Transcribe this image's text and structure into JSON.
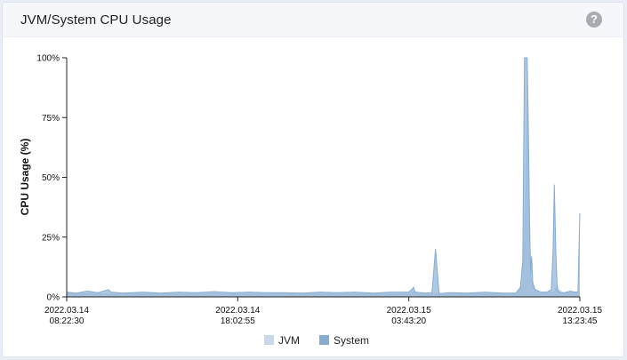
{
  "panel": {
    "title": "JVM/System CPU Usage",
    "help_icon": "question-circle-icon",
    "help_glyph": "?"
  },
  "chart_data": {
    "type": "area",
    "ylabel": "CPU Usage (%)",
    "ylim": [
      0,
      100
    ],
    "yticks": [
      {
        "value": 0,
        "label": "0%"
      },
      {
        "value": 25,
        "label": "25%"
      },
      {
        "value": 50,
        "label": "50%"
      },
      {
        "value": 75,
        "label": "75%"
      },
      {
        "value": 100,
        "label": "100%"
      }
    ],
    "xlim": [
      "2022-03-14T08:22:30",
      "2022-03-15T13:23:45"
    ],
    "xticks": [
      {
        "value": "2022-03-14T08:22:30",
        "date": "2022.03.14",
        "time": "08:22:30"
      },
      {
        "value": "2022-03-14T18:02:55",
        "date": "2022.03.14",
        "time": "18:02:55"
      },
      {
        "value": "2022-03-15T03:43:20",
        "date": "2022.03.15",
        "time": "03:43:20"
      },
      {
        "value": "2022-03-15T13:23:45",
        "date": "2022.03.15",
        "time": "13:23:45"
      }
    ],
    "legend_position": "bottom-center",
    "grid": false,
    "series": [
      {
        "name": "JVM",
        "color": "#c9d9ec",
        "points": [
          [
            "2022-03-14T08:22:30",
            1.5
          ],
          [
            "2022-03-14T09:32:00",
            1.4
          ],
          [
            "2022-03-14T10:44:00",
            1.2
          ],
          [
            "2022-03-14T11:42:00",
            1.3
          ],
          [
            "2022-03-14T13:42:00",
            1.3
          ],
          [
            "2022-03-14T15:42:00",
            1.2
          ],
          [
            "2022-03-14T17:42:00",
            1.3
          ],
          [
            "2022-03-14T19:42:00",
            1.2
          ],
          [
            "2022-03-14T21:42:00",
            1.3
          ],
          [
            "2022-03-14T23:42:00",
            1.2
          ],
          [
            "2022-03-15T01:42:00",
            1.3
          ],
          [
            "2022-03-15T02:42:00",
            1.2
          ],
          [
            "2022-03-15T03:42:00",
            1.3
          ],
          [
            "2022-03-15T03:59:00",
            2.0
          ],
          [
            "2022-03-15T04:12:00",
            1.2
          ],
          [
            "2022-03-15T05:02:00",
            1.2
          ],
          [
            "2022-03-15T05:14:00",
            1.6
          ],
          [
            "2022-03-15T05:26:00",
            1.0
          ],
          [
            "2022-03-15T06:42:00",
            1.2
          ],
          [
            "2022-03-15T08:42:00",
            1.3
          ],
          [
            "2022-03-15T09:47:00",
            1.3
          ],
          [
            "2022-03-15T10:10:00",
            5.0
          ],
          [
            "2022-03-15T10:19:00",
            35.0
          ],
          [
            "2022-03-15T10:27:00",
            85.0
          ],
          [
            "2022-03-15T10:32:00",
            40.0
          ],
          [
            "2022-03-15T10:37:00",
            8.0
          ],
          [
            "2022-03-15T10:47:00",
            4.0
          ],
          [
            "2022-03-15T11:02:00",
            1.5
          ],
          [
            "2022-03-15T11:32:00",
            1.5
          ],
          [
            "2022-03-15T11:57:00",
            2.0
          ],
          [
            "2022-03-15T12:07:00",
            5.0
          ],
          [
            "2022-03-15T12:12:00",
            3.0
          ],
          [
            "2022-03-15T12:32:00",
            1.5
          ],
          [
            "2022-03-15T13:02:00",
            2.0
          ],
          [
            "2022-03-15T13:23:45",
            2.0
          ]
        ]
      },
      {
        "name": "System",
        "color": "#86acd0",
        "points": [
          [
            "2022-03-14T08:22:30",
            2.0
          ],
          [
            "2022-03-14T08:56:00",
            1.6
          ],
          [
            "2022-03-14T09:32:00",
            2.4
          ],
          [
            "2022-03-14T10:09:00",
            1.8
          ],
          [
            "2022-03-14T10:44:00",
            3.0
          ],
          [
            "2022-03-14T10:54:00",
            2.0
          ],
          [
            "2022-03-14T11:32:00",
            1.6
          ],
          [
            "2022-03-14T12:42:00",
            2.0
          ],
          [
            "2022-03-14T13:42:00",
            1.6
          ],
          [
            "2022-03-14T14:42:00",
            2.0
          ],
          [
            "2022-03-14T15:42:00",
            1.8
          ],
          [
            "2022-03-14T16:42:00",
            2.2
          ],
          [
            "2022-03-14T17:42:00",
            1.8
          ],
          [
            "2022-03-14T18:42:00",
            2.0
          ],
          [
            "2022-03-14T19:42:00",
            1.8
          ],
          [
            "2022-03-14T20:42:00",
            1.8
          ],
          [
            "2022-03-14T21:42:00",
            1.6
          ],
          [
            "2022-03-14T22:42:00",
            2.0
          ],
          [
            "2022-03-14T23:42:00",
            1.8
          ],
          [
            "2022-03-15T00:42:00",
            2.0
          ],
          [
            "2022-03-15T01:42:00",
            1.6
          ],
          [
            "2022-03-15T02:42:00",
            2.0
          ],
          [
            "2022-03-15T03:42:00",
            2.0
          ],
          [
            "2022-03-15T03:53:00",
            3.0
          ],
          [
            "2022-03-15T03:59:00",
            4.0
          ],
          [
            "2022-03-15T04:05:00",
            2.0
          ],
          [
            "2022-03-15T04:42:00",
            1.6
          ],
          [
            "2022-03-15T05:02:00",
            1.8
          ],
          [
            "2022-03-15T05:14:00",
            20.0
          ],
          [
            "2022-03-15T05:26:00",
            1.4
          ],
          [
            "2022-03-15T06:02:00",
            1.8
          ],
          [
            "2022-03-15T07:02:00",
            1.6
          ],
          [
            "2022-03-15T08:02:00",
            2.0
          ],
          [
            "2022-03-15T09:02:00",
            1.6
          ],
          [
            "2022-03-15T09:47:00",
            1.6
          ],
          [
            "2022-03-15T10:02:00",
            4.0
          ],
          [
            "2022-03-15T10:10:00",
            15.0
          ],
          [
            "2022-03-15T10:13:00",
            60.0
          ],
          [
            "2022-03-15T10:16:00",
            100.0
          ],
          [
            "2022-03-15T10:19:00",
            100.0
          ],
          [
            "2022-03-15T10:22:00",
            100.0
          ],
          [
            "2022-03-15T10:25:00",
            100.0
          ],
          [
            "2022-03-15T10:29:00",
            70.0
          ],
          [
            "2022-03-15T10:34:00",
            25.0
          ],
          [
            "2022-03-15T10:37:00",
            10.0
          ],
          [
            "2022-03-15T10:40:00",
            17.0
          ],
          [
            "2022-03-15T10:44:00",
            6.0
          ],
          [
            "2022-03-15T10:52:00",
            3.0
          ],
          [
            "2022-03-15T11:12:00",
            2.0
          ],
          [
            "2022-03-15T11:32:00",
            2.0
          ],
          [
            "2022-03-15T11:47:00",
            3.0
          ],
          [
            "2022-03-15T11:53:00",
            20.0
          ],
          [
            "2022-03-15T11:57:00",
            47.0
          ],
          [
            "2022-03-15T12:02:00",
            20.0
          ],
          [
            "2022-03-15T12:07:00",
            3.0
          ],
          [
            "2022-03-15T12:17:00",
            1.8
          ],
          [
            "2022-03-15T12:32:00",
            1.8
          ],
          [
            "2022-03-15T12:52:00",
            2.4
          ],
          [
            "2022-03-15T13:07:00",
            2.0
          ],
          [
            "2022-03-15T13:17:00",
            2.0
          ],
          [
            "2022-03-15T13:23:45",
            35.0
          ]
        ]
      }
    ]
  }
}
